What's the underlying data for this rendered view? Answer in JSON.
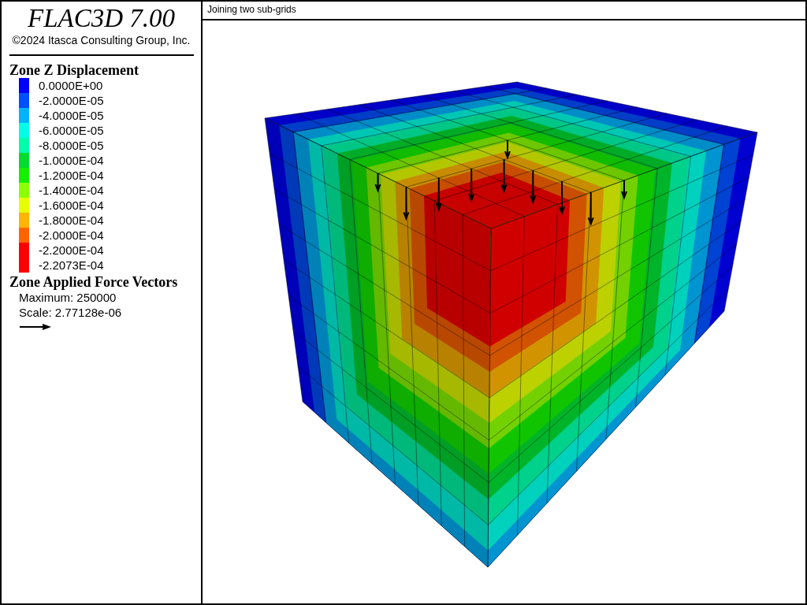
{
  "title_panel": {
    "product": "FLAC3D 7.00",
    "copyright": "©2024 Itasca Consulting Group, Inc."
  },
  "legend": {
    "title": "Zone Z Displacement",
    "entries": [
      {
        "label": "0.0000E+00",
        "color": "#0000ff"
      },
      {
        "label": "-2.0000E-05",
        "color": "#0050ff"
      },
      {
        "label": "-4.0000E-05",
        "color": "#00b4ff"
      },
      {
        "label": "-6.0000E-05",
        "color": "#00ffe6"
      },
      {
        "label": "-8.0000E-05",
        "color": "#00ffaa"
      },
      {
        "label": "-1.0000E-04",
        "color": "#00dc32"
      },
      {
        "label": "-1.2000E-04",
        "color": "#14f000"
      },
      {
        "label": "-1.4000E-04",
        "color": "#8cff00"
      },
      {
        "label": "-1.6000E-04",
        "color": "#e6ff00"
      },
      {
        "label": "-1.8000E-04",
        "color": "#ffb400"
      },
      {
        "label": "-2.0000E-04",
        "color": "#ff6400"
      },
      {
        "label": "-2.2000E-04",
        "color": "#ff0000"
      },
      {
        "label": "-2.2073E-04",
        "color": "#ff0000"
      }
    ]
  },
  "vectors": {
    "title": "Zone Applied Force Vectors",
    "maximum": "Maximum: 250000",
    "scale": "Scale: 2.77128e-06"
  },
  "plot": {
    "title": "Joining two sub-grids"
  }
}
